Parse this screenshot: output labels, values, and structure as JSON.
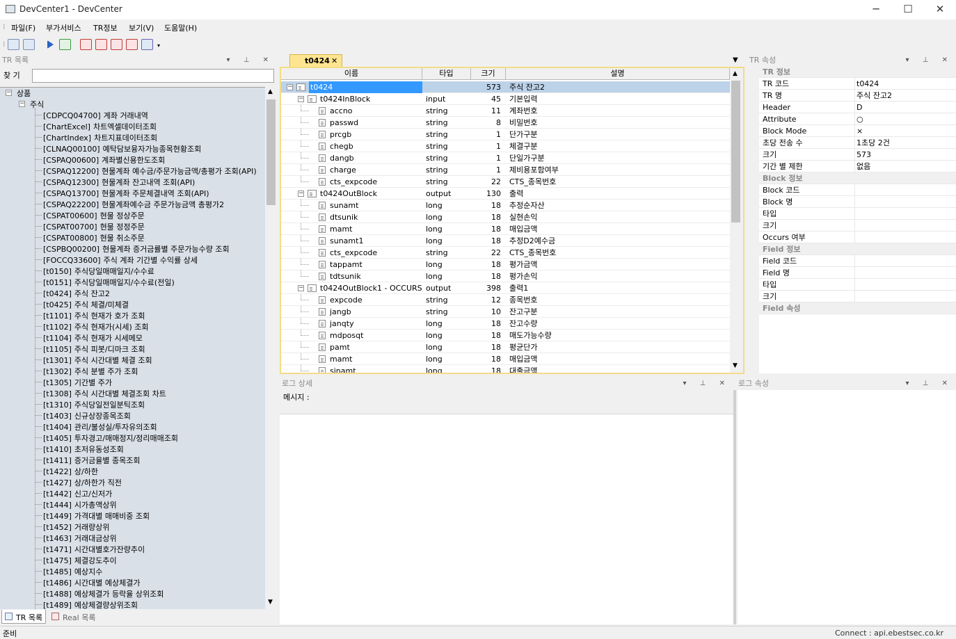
{
  "window": {
    "title": "DevCenter1 - DevCenter",
    "min": "─",
    "max": "☐",
    "close": "✕"
  },
  "menu": [
    "파일(F)",
    "부가서비스",
    "TR정보",
    "보기(V)",
    "도움말(H)"
  ],
  "tr_panel": {
    "title": "TR 목록",
    "search_label": "찾 기",
    "search_value": "",
    "root": "상품",
    "group": "주식",
    "items": [
      {
        "code": "[CDPCQ04700]",
        "name": "계좌 거래내역"
      },
      {
        "code": "[ChartExcel]",
        "name": "차트엑셀데이터조회"
      },
      {
        "code": "[ChartIndex]",
        "name": "차트지표데이터조회"
      },
      {
        "code": "[CLNAQ00100]",
        "name": "예탁담보융자가능종목현황조회"
      },
      {
        "code": "[CSPAQ00600]",
        "name": "계좌별신용한도조회"
      },
      {
        "code": "[CSPAQ12200]",
        "name": "현물계좌 예수금/주문가능금액/총평가 조회(API)"
      },
      {
        "code": "[CSPAQ12300]",
        "name": "현물계좌 잔고내역 조회(API)"
      },
      {
        "code": "[CSPAQ13700]",
        "name": "현물계좌 주문체결내역 조회(API)"
      },
      {
        "code": "[CSPAQ22200]",
        "name": "현물계좌예수금 주문가능금액 총평가2"
      },
      {
        "code": "[CSPAT00600]",
        "name": "현물 정상주문"
      },
      {
        "code": "[CSPAT00700]",
        "name": "현물 정정주문"
      },
      {
        "code": "[CSPAT00800]",
        "name": "현물 취소주문"
      },
      {
        "code": "[CSPBQ00200]",
        "name": "현물계좌 증거금률별 주문가능수량 조회"
      },
      {
        "code": "[FOCCQ33600]",
        "name": "주식 계좌 기간별 수익률 상세"
      },
      {
        "code": "[t0150]",
        "name": "주식당일매매일지/수수료"
      },
      {
        "code": "[t0151]",
        "name": "주식당일매매일지/수수료(전일)"
      },
      {
        "code": "[t0424]",
        "name": "주식 잔고2"
      },
      {
        "code": "[t0425]",
        "name": "주식 체결/미체결"
      },
      {
        "code": "[t1101]",
        "name": "주식 현재가 호가 조회"
      },
      {
        "code": "[t1102]",
        "name": "주식 현재가(시세) 조회"
      },
      {
        "code": "[t1104]",
        "name": "주식 현재가 시세메모"
      },
      {
        "code": "[t1105]",
        "name": "주식 피봇/디마크 조회"
      },
      {
        "code": "[t1301]",
        "name": "주식 시간대별 체결 조회"
      },
      {
        "code": "[t1302]",
        "name": "주식 분별 주가 조회"
      },
      {
        "code": "[t1305]",
        "name": "기간별 주가"
      },
      {
        "code": "[t1308]",
        "name": "주식 시간대별 체결조회 차트"
      },
      {
        "code": "[t1310]",
        "name": "주식당일전일분틱조회"
      },
      {
        "code": "[t1403]",
        "name": "신규상장종목조회"
      },
      {
        "code": "[t1404]",
        "name": "관리/불성실/투자유의조회"
      },
      {
        "code": "[t1405]",
        "name": "투자경고/매매정지/정리매매조회"
      },
      {
        "code": "[t1410]",
        "name": "초저유동성조회"
      },
      {
        "code": "[t1411]",
        "name": "증거금율별 종목조회"
      },
      {
        "code": "[t1422]",
        "name": "상/하한"
      },
      {
        "code": "[t1427]",
        "name": "상/하한가 직전"
      },
      {
        "code": "[t1442]",
        "name": "신고/신저가"
      },
      {
        "code": "[t1444]",
        "name": "시가총액상위"
      },
      {
        "code": "[t1449]",
        "name": "가격대별 매매비중 조회"
      },
      {
        "code": "[t1452]",
        "name": "거래량상위"
      },
      {
        "code": "[t1463]",
        "name": "거래대금상위"
      },
      {
        "code": "[t1471]",
        "name": "시간대별호가잔량추이"
      },
      {
        "code": "[t1475]",
        "name": "체결강도추이"
      },
      {
        "code": "[t1485]",
        "name": "예상지수"
      },
      {
        "code": "[t1486]",
        "name": "시간대별 예상체결가"
      },
      {
        "code": "[t1488]",
        "name": "예상체결가 등락율 상위조회"
      },
      {
        "code": "[t1489]",
        "name": "예상체결량상위조회"
      }
    ],
    "tabs": [
      "TR 목록",
      "Real 목록"
    ]
  },
  "doc_tab": {
    "label": "t0424",
    "close": "✕"
  },
  "grid": {
    "headers": [
      "이름",
      "타입",
      "크기",
      "설명"
    ],
    "rows": [
      {
        "level": 0,
        "name": "t0424",
        "type": "",
        "size": "573",
        "desc": "주식 잔고2",
        "exp": "−",
        "sel": true
      },
      {
        "level": 1,
        "name": "t0424InBlock",
        "type": "input",
        "size": "45",
        "desc": "기본입력",
        "exp": "−"
      },
      {
        "level": 2,
        "name": "accno",
        "type": "string",
        "size": "11",
        "desc": "계좌번호"
      },
      {
        "level": 2,
        "name": "passwd",
        "type": "string",
        "size": "8",
        "desc": "비밀번호"
      },
      {
        "level": 2,
        "name": "prcgb",
        "type": "string",
        "size": "1",
        "desc": "단가구분"
      },
      {
        "level": 2,
        "name": "chegb",
        "type": "string",
        "size": "1",
        "desc": "체결구분"
      },
      {
        "level": 2,
        "name": "dangb",
        "type": "string",
        "size": "1",
        "desc": "단일가구분"
      },
      {
        "level": 2,
        "name": "charge",
        "type": "string",
        "size": "1",
        "desc": "제비용포함여부"
      },
      {
        "level": 2,
        "name": "cts_expcode",
        "type": "string",
        "size": "22",
        "desc": "CTS_종목번호"
      },
      {
        "level": 1,
        "name": "t0424OutBlock",
        "type": "output",
        "size": "130",
        "desc": "출력",
        "exp": "−"
      },
      {
        "level": 2,
        "name": "sunamt",
        "type": "long",
        "size": "18",
        "desc": "추정순자산"
      },
      {
        "level": 2,
        "name": "dtsunik",
        "type": "long",
        "size": "18",
        "desc": "실현손익"
      },
      {
        "level": 2,
        "name": "mamt",
        "type": "long",
        "size": "18",
        "desc": "매입금액"
      },
      {
        "level": 2,
        "name": "sunamt1",
        "type": "long",
        "size": "18",
        "desc": "추정D2예수금"
      },
      {
        "level": 2,
        "name": "cts_expcode",
        "type": "string",
        "size": "22",
        "desc": "CTS_종목번호"
      },
      {
        "level": 2,
        "name": "tappamt",
        "type": "long",
        "size": "18",
        "desc": "평가금액"
      },
      {
        "level": 2,
        "name": "tdtsunik",
        "type": "long",
        "size": "18",
        "desc": "평가손익"
      },
      {
        "level": 1,
        "name": "t0424OutBlock1 - OCCURS",
        "type": "output",
        "size": "398",
        "desc": "출력1",
        "exp": "−"
      },
      {
        "level": 2,
        "name": "expcode",
        "type": "string",
        "size": "12",
        "desc": "종목번호"
      },
      {
        "level": 2,
        "name": "jangb",
        "type": "string",
        "size": "10",
        "desc": "잔고구분"
      },
      {
        "level": 2,
        "name": "janqty",
        "type": "long",
        "size": "18",
        "desc": "잔고수량"
      },
      {
        "level": 2,
        "name": "mdposqt",
        "type": "long",
        "size": "18",
        "desc": "매도가능수량"
      },
      {
        "level": 2,
        "name": "pamt",
        "type": "long",
        "size": "18",
        "desc": "평균단가"
      },
      {
        "level": 2,
        "name": "mamt",
        "type": "long",
        "size": "18",
        "desc": "매입금액"
      },
      {
        "level": 2,
        "name": "sinamt",
        "type": "long",
        "size": "18",
        "desc": "대출금액"
      }
    ]
  },
  "tr_props": {
    "title": "TR 속성",
    "rows": [
      {
        "k": "TR 정보",
        "v": "",
        "cat": true
      },
      {
        "k": "TR 코드",
        "v": "t0424"
      },
      {
        "k": "TR 명",
        "v": "주식 잔고2"
      },
      {
        "k": "Header",
        "v": "D"
      },
      {
        "k": "Attribute",
        "v": "○"
      },
      {
        "k": "Block Mode",
        "v": "×"
      },
      {
        "k": "초당 전송 수",
        "v": "1초당 2건"
      },
      {
        "k": "크기",
        "v": "573"
      },
      {
        "k": "기간 별 제한",
        "v": "없음"
      },
      {
        "k": "Block 정보",
        "v": "",
        "cat": true
      },
      {
        "k": "Block 코드",
        "v": ""
      },
      {
        "k": "Block 명",
        "v": ""
      },
      {
        "k": "타입",
        "v": ""
      },
      {
        "k": "크기",
        "v": ""
      },
      {
        "k": "Occurs 여부",
        "v": ""
      },
      {
        "k": "Field 정보",
        "v": "",
        "cat": true
      },
      {
        "k": "Field 코드",
        "v": ""
      },
      {
        "k": "Field 명",
        "v": ""
      },
      {
        "k": "타입",
        "v": ""
      },
      {
        "k": "크기",
        "v": ""
      },
      {
        "k": "Field 속성",
        "v": "",
        "cat": true
      }
    ]
  },
  "log_detail": {
    "title": "로그 상세",
    "message_label": "메시지 :"
  },
  "log_props": {
    "title": "로그 속성"
  },
  "status": {
    "left": "준비",
    "right": "Connect : api.ebestsec.co.kr"
  }
}
